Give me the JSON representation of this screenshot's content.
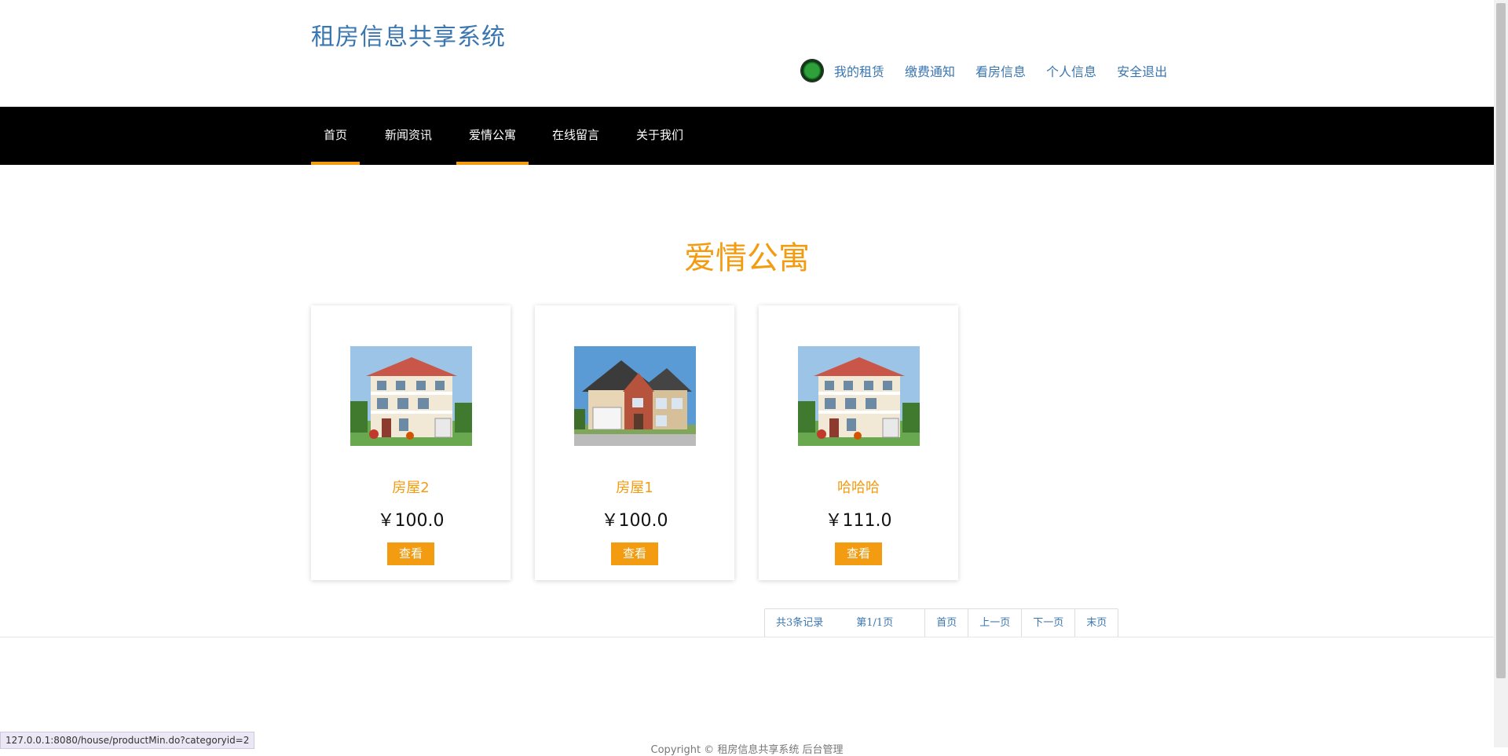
{
  "header": {
    "site_title": "租房信息共享系统",
    "top_links": [
      "我的租赁",
      "缴费通知",
      "看房信息",
      "个人信息",
      "安全退出"
    ]
  },
  "nav": {
    "items": [
      "首页",
      "新闻资讯",
      "爱情公寓",
      "在线留言",
      "关于我们"
    ],
    "active": [
      "首页",
      "爱情公寓"
    ]
  },
  "section": {
    "title": "爱情公寓"
  },
  "cards": [
    {
      "name": "房屋2",
      "price": "￥100.0",
      "button": "查看",
      "image": "villa-house-photo"
    },
    {
      "name": "房屋1",
      "price": "￥100.0",
      "button": "查看",
      "image": "suburban-house-photo"
    },
    {
      "name": "哈哈哈",
      "price": "￥111.0",
      "button": "查看",
      "image": "villa-house-photo"
    }
  ],
  "pagination": {
    "total": "共3条记录",
    "page": "第1/1页",
    "first": "首页",
    "prev": "上一页",
    "next": "下一页",
    "last": "末页"
  },
  "footer": {
    "text": "Copyright © 租房信息共享系统 后台管理"
  },
  "status_bar": {
    "url": "127.0.0.1:8080/house/productMin.do?categoryid=2"
  },
  "colors": {
    "accent": "#f39c12",
    "link": "#3a76b0",
    "navbar": "#000000"
  }
}
